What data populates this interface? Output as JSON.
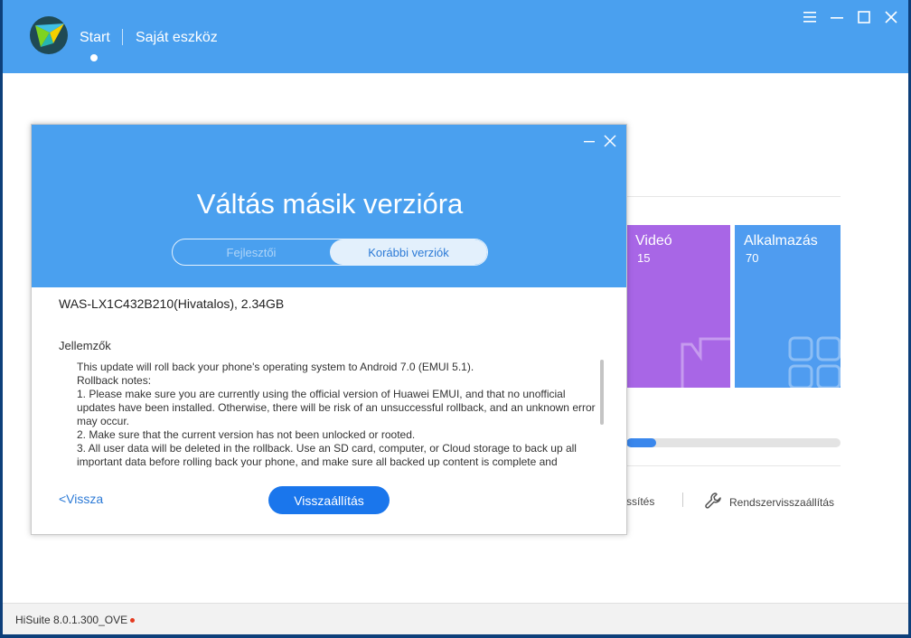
{
  "header": {
    "nav_start": "Start",
    "nav_device": "Saját eszköz"
  },
  "tiles": [
    {
      "name": "Videó",
      "count": "15",
      "color": "#a866e6"
    },
    {
      "name": "Alkalmazás",
      "count": "70",
      "color": "#4f9cf0"
    }
  ],
  "progress": {
    "fraction": 0.14
  },
  "tools": {
    "refresh_partial": "ssítés",
    "system_restore": "Rendszervisszaállítás"
  },
  "footer": {
    "version": "HiSuite 8.0.1.300_OVE"
  },
  "dialog": {
    "title": "Váltás másik verzióra",
    "tabs": [
      {
        "label": "Fejlesztői",
        "active": false
      },
      {
        "label": "Korábbi verziók",
        "active": true
      }
    ],
    "firmware": "WAS-LX1C432B210(Hivatalos), 2.34GB",
    "features_label": "Jellemzők",
    "notes": [
      "This update will roll back your phone's operating system to Android 7.0 (EMUI 5.1).",
      "Rollback notes:",
      "1. Please make sure you are currently using the official version of Huawei EMUI, and that no unofficial updates have been installed. Otherwise, there will be risk of an unsuccessful rollback, and an unknown error may occur.",
      "2. Make sure that the current version has not been unlocked or rooted.",
      "3. All user data will be deleted in the rollback. Use an SD card, computer, or Cloud storage to back up all important data before rolling back your phone, and make sure all backed up content is complete and"
    ],
    "back_label": "<Vissza",
    "restore_label": "Visszaállítás"
  },
  "colors": {
    "accent": "#4aa0ef",
    "button": "#1a76ec",
    "link": "#2c7ad6"
  },
  "icons": [
    "app-logo-icon",
    "menu-icon",
    "minimize-icon",
    "maximize-icon",
    "close-icon",
    "video-icon",
    "apps-grid-icon",
    "wrench-icon"
  ]
}
